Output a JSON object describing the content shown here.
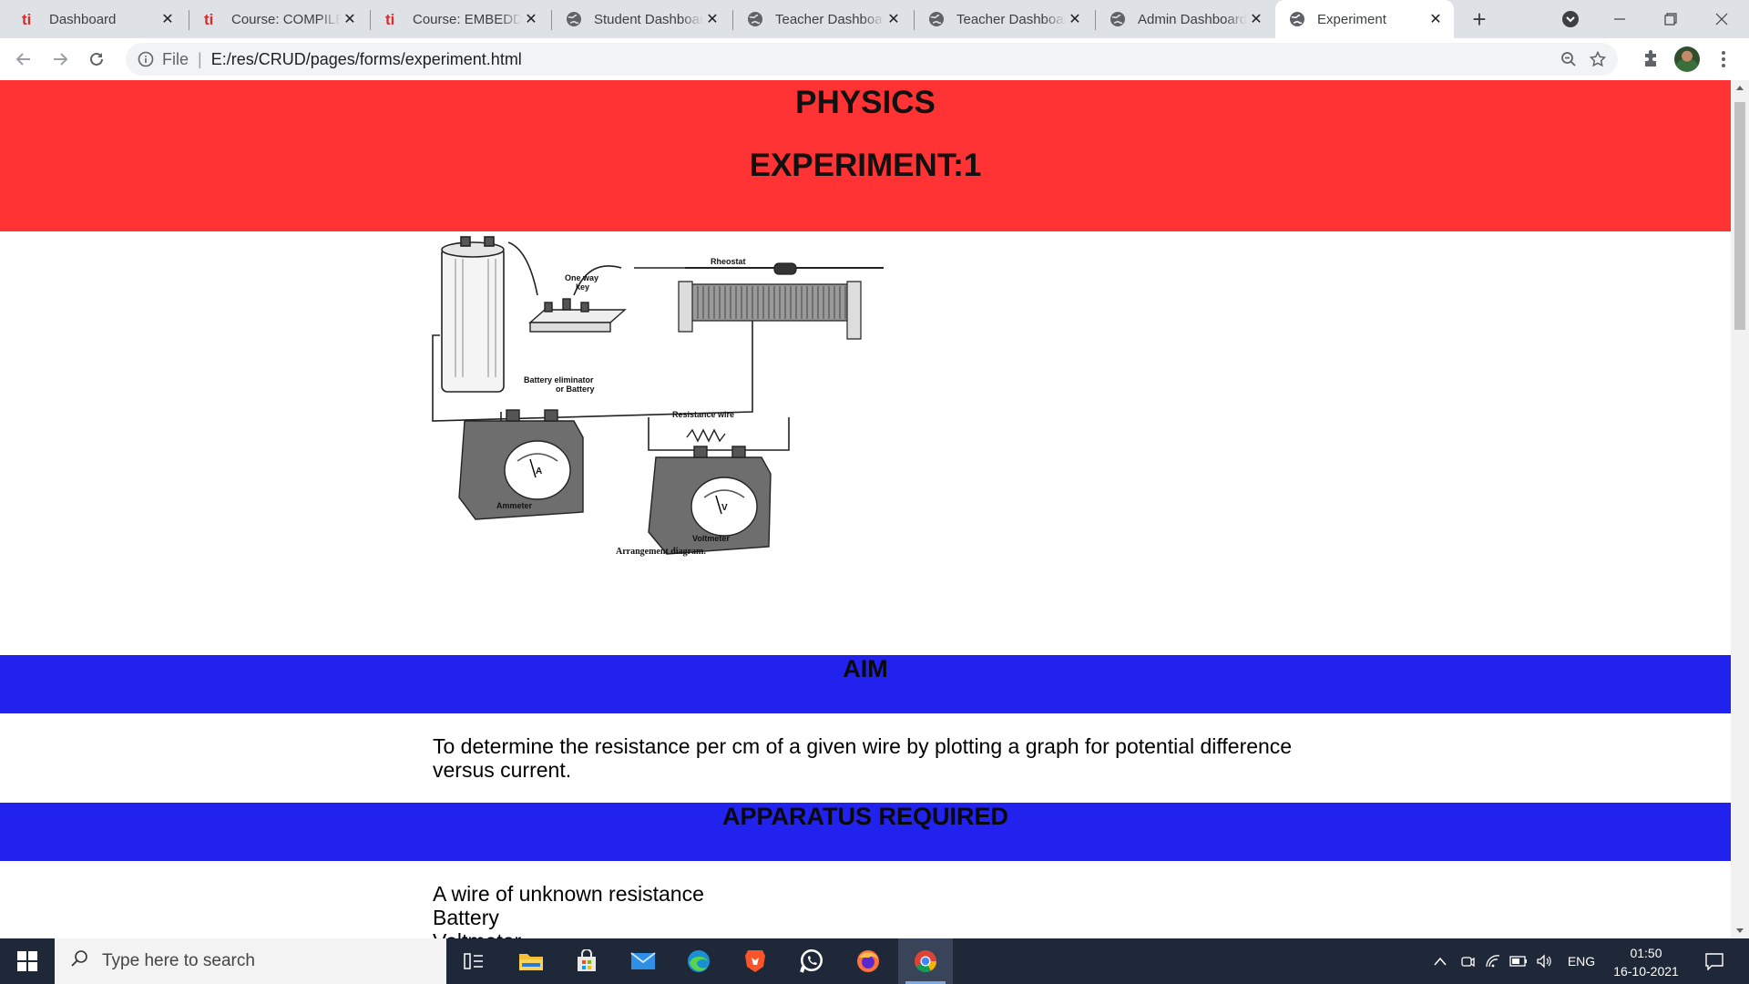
{
  "browser": {
    "tabs": [
      {
        "title": "Dashboard",
        "favicon": "ti-logo-icon"
      },
      {
        "title": "Course: COMPILER DESIGN",
        "favicon": "ti-logo-icon"
      },
      {
        "title": "Course: EMBEDDED SYSTEMS",
        "favicon": "ti-logo-icon"
      },
      {
        "title": "Student Dashboard",
        "favicon": "globe-icon"
      },
      {
        "title": "Teacher Dashboard",
        "favicon": "globe-icon"
      },
      {
        "title": "Teacher Dashboard",
        "favicon": "globe-icon"
      },
      {
        "title": "Admin Dashboard",
        "favicon": "globe-icon"
      },
      {
        "title": "Experiment",
        "favicon": "globe-icon",
        "active": true
      }
    ],
    "address": {
      "scheme_label": "File",
      "url": "E:/res/CRUD/pages/forms/experiment.html"
    }
  },
  "page": {
    "subject": "PHYSICS",
    "experiment": "EXPERIMENT:1",
    "diagram": {
      "labels": {
        "one_way_key": "One way key",
        "one_way_key_1": "One way",
        "one_way_key_2": "key",
        "rheostat": "Rheostat",
        "battery_1": "Battery eliminator",
        "battery_2": "or Battery",
        "resistance_wire": "Resistance wire",
        "ammeter": "Ammeter",
        "voltmeter": "Voltmeter",
        "caption": "Arrangement diagram.",
        "a": "A",
        "v": "V"
      }
    },
    "aim_heading": "AIM",
    "aim_text": "To determine the resistance per cm of a given wire by plotting a graph for potential difference versus current.",
    "apparatus_heading": "APPARATUS REQUIRED",
    "apparatus": [
      "A wire of unknown resistance",
      "Battery",
      "Voltmeter"
    ]
  },
  "taskbar": {
    "search_placeholder": "Type here to search",
    "apps": [
      "task-view-icon",
      "file-explorer-icon",
      "microsoft-store-icon",
      "mail-icon",
      "edge-icon",
      "brave-icon",
      "whatsapp-icon",
      "firefox-icon",
      "chrome-icon"
    ],
    "language": "ENG",
    "time": "01:50",
    "date": "16-10-2021"
  },
  "colors": {
    "header_red": "#ff3333",
    "band_blue": "#2222ee"
  }
}
